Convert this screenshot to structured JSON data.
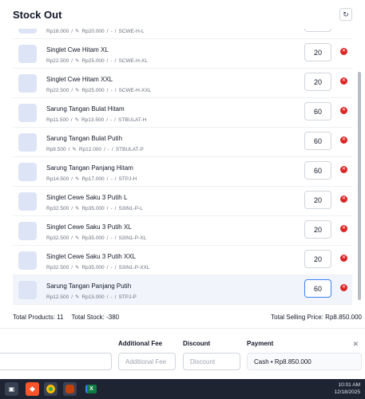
{
  "header": {
    "title": "Stock Out",
    "refresh_icon": "refresh-icon"
  },
  "items": [
    {
      "name": "Singlet Cwe Hitam L",
      "buy": "Rp18.000",
      "sell": "Rp20.000",
      "extra": "-",
      "sku": "SCWE-H-L",
      "qty": "20"
    },
    {
      "name": "Singlet Cwe Hitam XL",
      "buy": "Rp22.500",
      "sell": "Rp25.000",
      "extra": "-",
      "sku": "SCWE-H-XL",
      "qty": "20"
    },
    {
      "name": "Singlet Cwe Hitam XXL",
      "buy": "Rp22.500",
      "sell": "Rp25.000",
      "extra": "-",
      "sku": "SCWE-H-XXL",
      "qty": "20"
    },
    {
      "name": "Sarung Tangan Bulat Hitam",
      "buy": "Rp11.500",
      "sell": "Rp13.500",
      "extra": "-",
      "sku": "STBULAT-H",
      "qty": "60"
    },
    {
      "name": "Sarung Tangan Bulat Putih",
      "buy": "Rp9.500",
      "sell": "Rp12.000",
      "extra": "-",
      "sku": "STBULAT-P",
      "qty": "60"
    },
    {
      "name": "Sarung Tangan Panjang Hitam",
      "buy": "Rp14.500",
      "sell": "Rp17.000",
      "extra": "-",
      "sku": "STPJ-H",
      "qty": "60"
    },
    {
      "name": "Singlet Cewe Saku 3 Putih L",
      "buy": "Rp32.500",
      "sell": "Rp35.000",
      "extra": "-",
      "sku": "S3IN1-P-L",
      "qty": "20"
    },
    {
      "name": "Singlet Cewe Saku 3 Putih XL",
      "buy": "Rp32.500",
      "sell": "Rp35.000",
      "extra": "-",
      "sku": "S3IN1-P-XL",
      "qty": "20"
    },
    {
      "name": "Singlet Cewe Saku 3 Putih XXL",
      "buy": "Rp32.500",
      "sell": "Rp35.000",
      "extra": "-",
      "sku": "S3IN1-P-XXL",
      "qty": "20"
    },
    {
      "name": "Sarung Tangan Panjang Putih",
      "buy": "Rp12.500",
      "sell": "Rp15.000",
      "extra": "-",
      "sku": "STPJ-P",
      "qty": "60"
    }
  ],
  "totals": {
    "products": "Total Products: 11",
    "stock": "Total Stock: -380",
    "selling": "Total Selling Price: Rp8.850.000"
  },
  "fees": {
    "additional_label": "Additional Fee",
    "additional_placeholder": "Additional Fee",
    "discount_label": "Discount",
    "discount_placeholder": "Discount",
    "payment_label": "Payment",
    "payment_value": "Cash  •  Rp8.850.000"
  },
  "taskbar": {
    "time": "10:01 AM",
    "date": "12/18/2025"
  },
  "colors": {
    "accent": "#3b82f6",
    "remove": "#dc2626",
    "thumb": "#dde4f6"
  }
}
